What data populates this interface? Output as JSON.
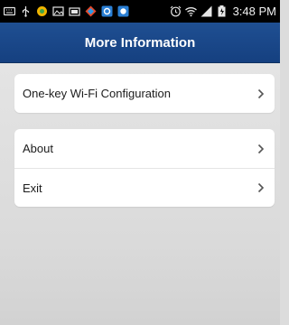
{
  "status_bar": {
    "time": "3:48 PM",
    "icons_left": [
      "keyboard-icon",
      "usb-icon",
      "app-icon",
      "photo-icon",
      "screenshot-icon",
      "app2-icon",
      "app3-icon",
      "alarm-icon"
    ],
    "icons_right": [
      "wifi-icon",
      "signal-icon",
      "battery-icon"
    ]
  },
  "header": {
    "title": "More Information",
    "color": "#1a4a8c"
  },
  "menu": {
    "group1": [
      {
        "label": "One-key Wi-Fi Configuration",
        "icon": "chevron-right-icon"
      }
    ],
    "group2": [
      {
        "label": "About",
        "icon": "chevron-right-icon"
      },
      {
        "label": "Exit",
        "icon": "chevron-right-icon"
      }
    ]
  },
  "colors": {
    "background": "#dcdcdc",
    "card": "#ffffff",
    "status_bar": "#000000"
  }
}
